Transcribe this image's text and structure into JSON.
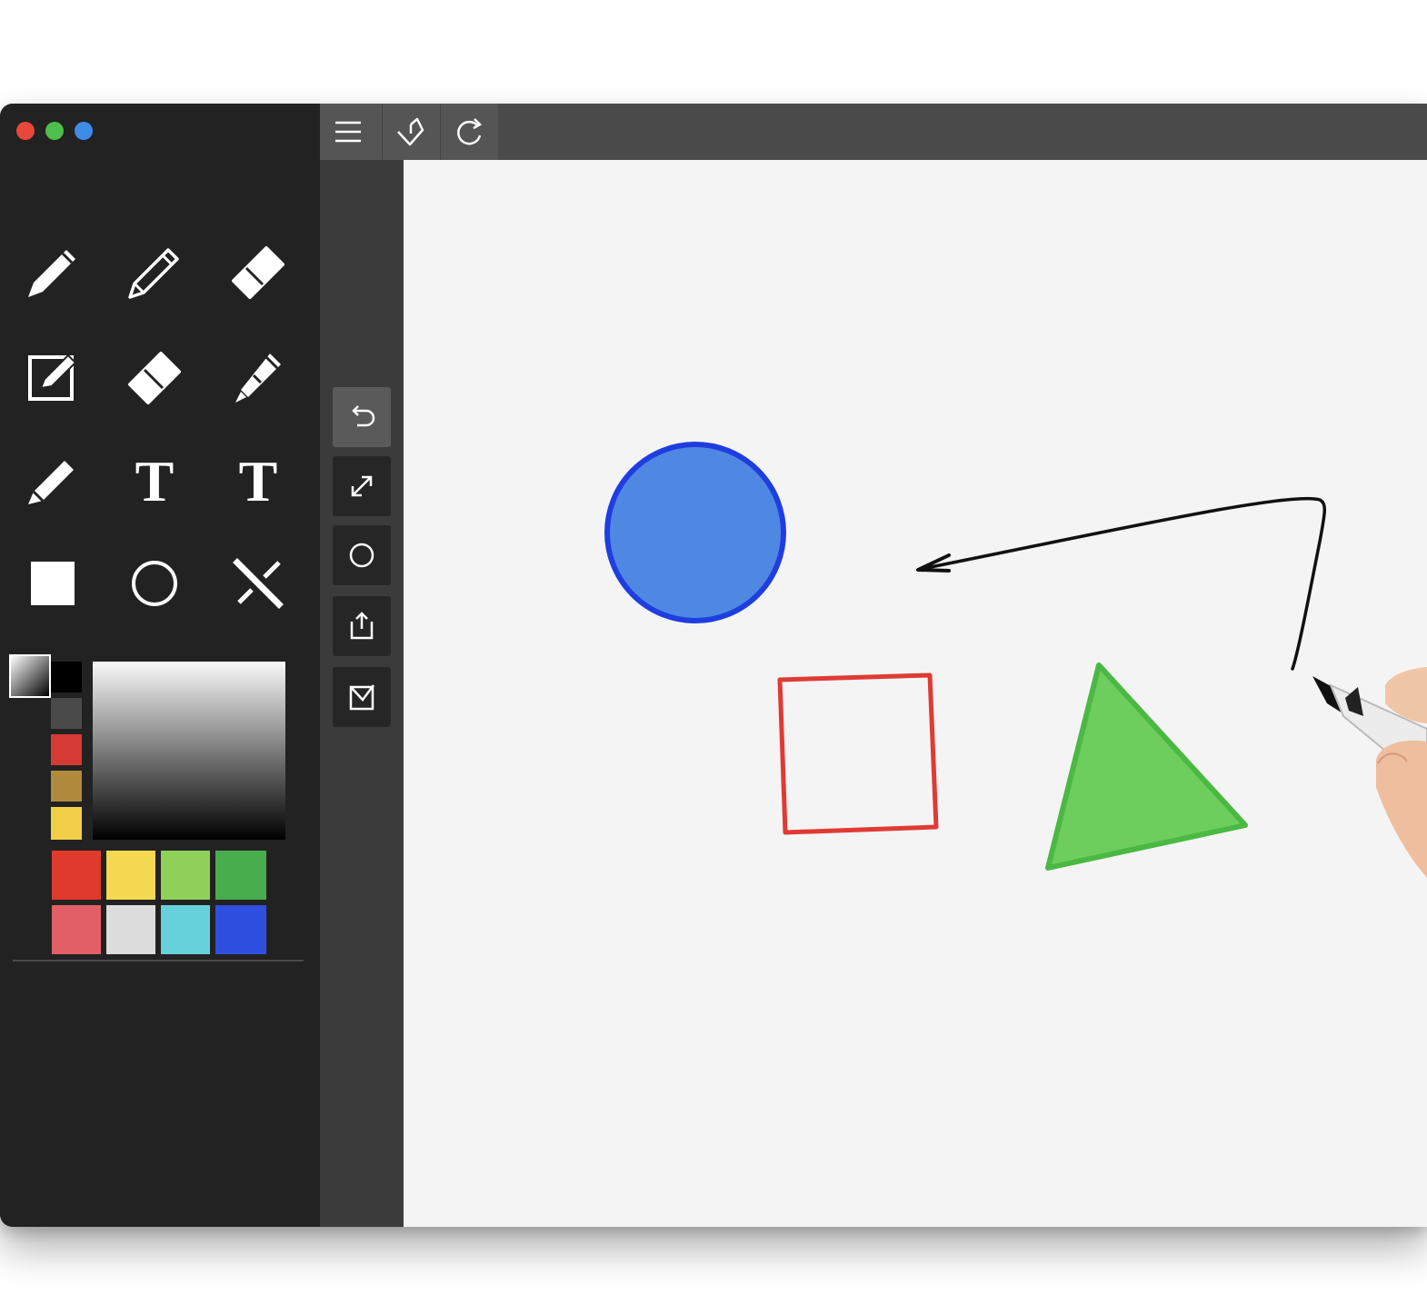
{
  "window": {
    "traffic_lights": [
      {
        "name": "close-button",
        "color": "#e8473b"
      },
      {
        "name": "minimize-button",
        "color": "#4cc04b"
      },
      {
        "name": "zoom-button",
        "color": "#3f8be8"
      }
    ]
  },
  "toolbar": {
    "buttons": [
      {
        "name": "menu-icon"
      },
      {
        "name": "pen-check-icon"
      },
      {
        "name": "redo-icon"
      }
    ]
  },
  "tools": [
    {
      "name": "pen-icon"
    },
    {
      "name": "pencil-icon"
    },
    {
      "name": "eraser-icon"
    },
    {
      "name": "edit-box-icon"
    },
    {
      "name": "eraser-alt-icon"
    },
    {
      "name": "highlighter-icon"
    },
    {
      "name": "marker-icon"
    },
    {
      "name": "text-serif-icon",
      "glyph": "T"
    },
    {
      "name": "text-icon",
      "glyph": "T"
    },
    {
      "name": "rectangle-icon"
    },
    {
      "name": "circle-icon"
    },
    {
      "name": "line-cross-icon"
    }
  ],
  "palette": {
    "column": [
      "#000000",
      "#4a4a4a",
      "#d63a34",
      "#b08a3d",
      "#f2cf49"
    ],
    "grid": [
      "#e03a2d",
      "#f5d851",
      "#8fd05a",
      "#48ad4c",
      "#e35f67",
      "#dcdcdc",
      "#67d1db",
      "#2f4fe0"
    ]
  },
  "side_actions": [
    {
      "name": "undo-icon",
      "active": true
    },
    {
      "name": "resize-icon",
      "active": false
    },
    {
      "name": "circle-tool-icon",
      "active": false
    },
    {
      "name": "export-icon",
      "active": false
    },
    {
      "name": "check-box-icon",
      "active": false
    }
  ],
  "drawing": {
    "circle_fill": "#4f88e3",
    "circle_stroke": "#1f3ee0",
    "square_stroke": "#e03a34",
    "triangle_fill": "#6dce5e",
    "triangle_stroke": "#4cb844",
    "arrow_color": "#111111"
  }
}
